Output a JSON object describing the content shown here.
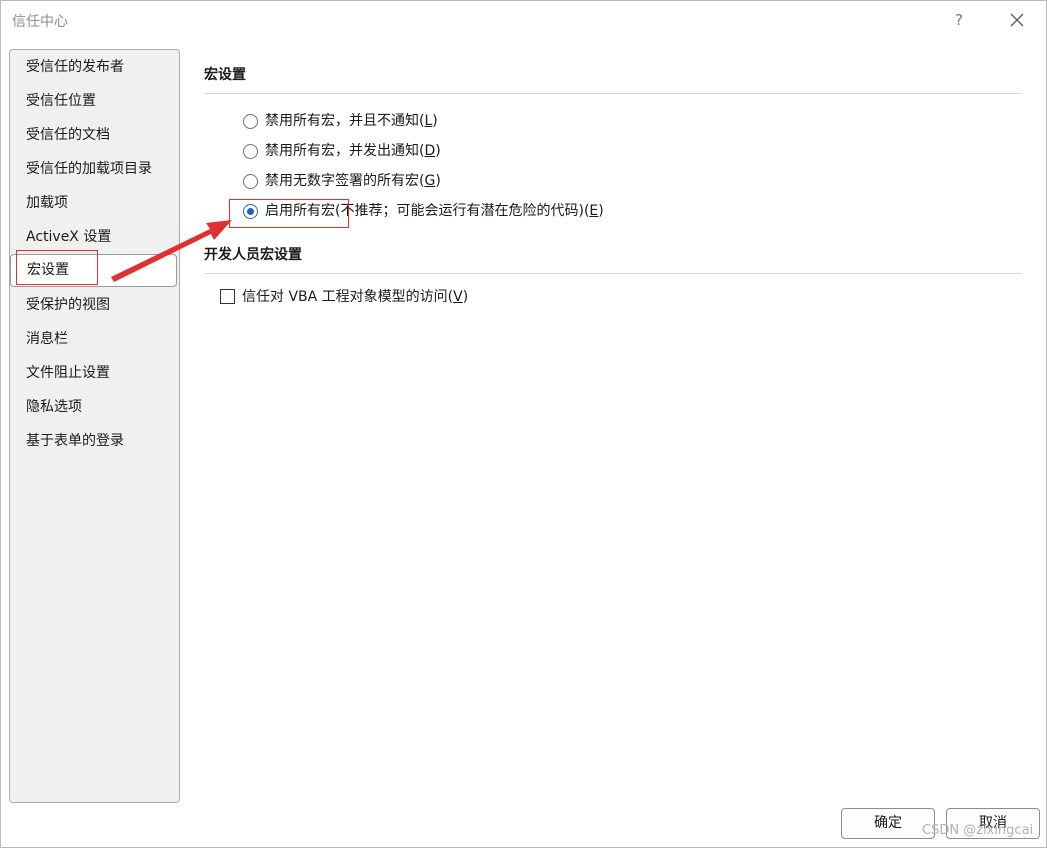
{
  "window": {
    "title": "信任中心",
    "help": "?"
  },
  "sidebar": {
    "items": [
      {
        "label": "受信任的发布者"
      },
      {
        "label": "受信任位置"
      },
      {
        "label": "受信任的文档"
      },
      {
        "label": "受信任的加载项目录"
      },
      {
        "label": "加载项"
      },
      {
        "label": "ActiveX 设置"
      },
      {
        "label": "宏设置",
        "selected": true
      },
      {
        "label": "受保护的视图"
      },
      {
        "label": "消息栏"
      },
      {
        "label": "文件阻止设置"
      },
      {
        "label": "隐私选项"
      },
      {
        "label": "基于表单的登录"
      }
    ]
  },
  "macro_settings": {
    "title": "宏设置",
    "options": [
      {
        "label": "禁用所有宏，并且不通知",
        "key": "L",
        "checked": false
      },
      {
        "label": "禁用所有宏，并发出通知",
        "key": "D",
        "checked": false
      },
      {
        "label": "禁用无数字签署的所有宏",
        "key": "G",
        "checked": false
      },
      {
        "label": "启用所有宏(不推荐；可能会运行有潜在危险的代码)",
        "key": "E",
        "checked": true
      }
    ]
  },
  "developer_settings": {
    "title": "开发人员宏设置",
    "trust_vba": {
      "label": "信任对 VBA 工程对象模型的访问",
      "key": "V",
      "checked": false
    }
  },
  "buttons": {
    "ok": "确定",
    "cancel": "取消"
  },
  "watermark": "CSDN @zixingcai",
  "colors": {
    "annotation": "#e03030",
    "radio_accent": "#1f5fbf"
  }
}
